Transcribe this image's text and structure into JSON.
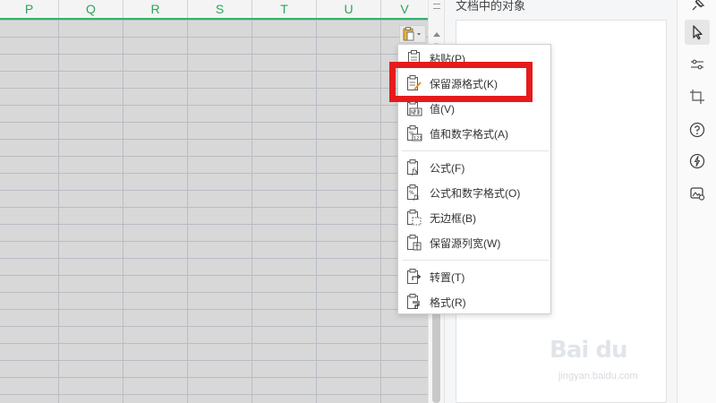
{
  "sheet": {
    "columns": [
      "P",
      "Q",
      "R",
      "S",
      "T",
      "U",
      "V"
    ],
    "header_color": "#2fb46a"
  },
  "pane": {
    "title": "文档中的对象"
  },
  "paste_menu": {
    "items": [
      {
        "label": "粘贴(P)",
        "icon": "paste-icon"
      },
      {
        "label": "保留源格式(K)",
        "icon": "keep-source-format-icon"
      },
      {
        "label": "值(V)",
        "icon": "paste-values-icon"
      },
      {
        "label": "值和数字格式(A)",
        "icon": "values-number-format-icon"
      },
      {
        "label": "公式(F)",
        "icon": "formulas-icon"
      },
      {
        "label": "公式和数字格式(O)",
        "icon": "formulas-number-format-icon"
      },
      {
        "label": "无边框(B)",
        "icon": "no-borders-icon"
      },
      {
        "label": "保留源列宽(W)",
        "icon": "keep-column-width-icon"
      },
      {
        "label": "转置(T)",
        "icon": "transpose-icon"
      },
      {
        "label": "格式(R)",
        "icon": "formatting-icon"
      }
    ],
    "highlighted_item": "保留源格式(K)",
    "highlight_color": "#e51b1b"
  },
  "right_toolbar": {
    "buttons": [
      "pin-icon",
      "select-pointer-icon",
      "adjust-icon",
      "crop-icon",
      "help-icon",
      "lightning-icon",
      "image-settings-icon"
    ]
  },
  "watermark": {
    "logo": "Bai du",
    "url": "jingyan.baidu.com"
  }
}
